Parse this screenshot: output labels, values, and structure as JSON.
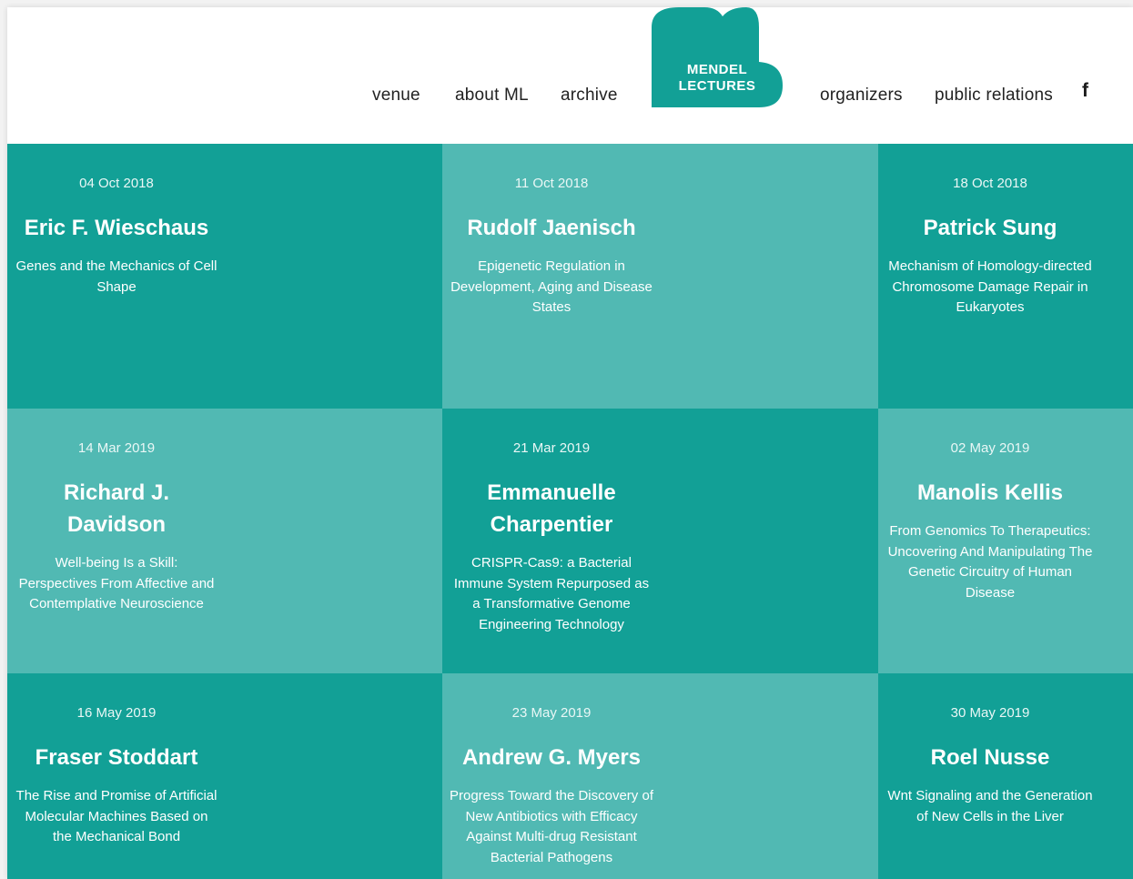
{
  "nav": {
    "venue": "venue",
    "about": "about ML",
    "archive": "archive",
    "organizers": "organizers",
    "public_relations": "public relations",
    "facebook": "f"
  },
  "logo": {
    "line1": "MENDEL",
    "line2": "LECTURES"
  },
  "colors": {
    "dark_tile": "#12a096",
    "light_tile": "#51b9b3",
    "logo": "#12a096"
  },
  "lectures": [
    {
      "date": "04 Oct 2018",
      "name": "Eric F. Wieschaus",
      "title": "Genes and the Mechanics of Cell Shape"
    },
    {
      "date": "11 Oct 2018",
      "name": "Rudolf Jaenisch",
      "title": "Epigenetic Regulation in Development, Aging and Disease States"
    },
    {
      "date": "18 Oct 2018",
      "name": "Patrick Sung",
      "title": "Mechanism of Homology-directed Chromosome Damage Repair in Eukaryotes"
    },
    {
      "date": "14 Mar 2019",
      "name": "Richard J. Davidson",
      "title": "Well-being Is a Skill: Perspectives From Affective and Contemplative Neuroscience"
    },
    {
      "date": "21 Mar 2019",
      "name": "Emmanuelle Charpentier",
      "title": "CRISPR-Cas9: a Bacterial Immune System Repurposed as a Transformative Genome Engineering Technology"
    },
    {
      "date": "02 May 2019",
      "name": "Manolis Kellis",
      "title": "From Genomics To Therapeutics: Uncovering And Manipulating The Genetic Circuitry of Human Disease"
    },
    {
      "date": "16 May 2019",
      "name": "Fraser Stoddart",
      "title": "The Rise and Promise of Artificial Molecular Machines Based on the Mechanical Bond"
    },
    {
      "date": "23 May 2019",
      "name": "Andrew G. Myers",
      "title": "Progress Toward the Discovery of New Antibiotics with Efficacy Against Multi-drug Resistant Bacterial Pathogens"
    },
    {
      "date": "30 May 2019",
      "name": "Roel Nusse",
      "title": "Wnt Signaling and the Generation of New Cells in the Liver"
    }
  ]
}
